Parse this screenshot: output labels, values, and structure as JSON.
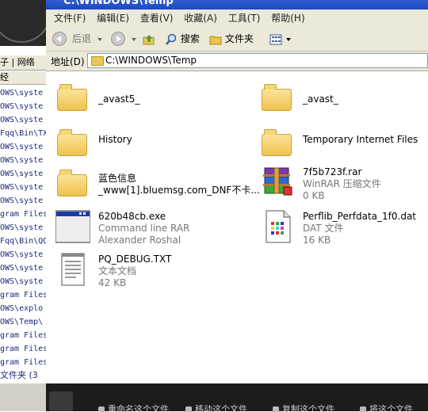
{
  "background_window": {
    "tabs_text": "子 | 网络",
    "header_text": "经",
    "rows": [
      "OWS\\syste",
      "OWS\\syste",
      "OWS\\syste",
      "Fqq\\Bin\\TX",
      "OWS\\syste",
      "OWS\\syste",
      "OWS\\syste",
      "OWS\\syste",
      "OWS\\syste",
      "gram Files",
      "OWS\\syste",
      "Fqq\\Bin\\QQ",
      "OWS\\syste",
      "OWS\\syste",
      "OWS\\syste",
      "gram Files",
      "OWS\\explo",
      "OWS\\Temp\\",
      "gram Files",
      "gram Files",
      "gram Files"
    ],
    "status": "文件夹 (3"
  },
  "window": {
    "title": "C:\\WINDOWS\\Temp"
  },
  "menu": [
    "文件(F)",
    "编辑(E)",
    "查看(V)",
    "收藏(A)",
    "工具(T)",
    "帮助(H)"
  ],
  "toolbar": {
    "back": "后退",
    "search": "搜索",
    "folders": "文件夹"
  },
  "address": {
    "label": "地址(D)",
    "value": "C:\\WINDOWS\\Temp"
  },
  "items": [
    {
      "name": "_avast5_",
      "line2": "",
      "line3": "",
      "icon": "folder"
    },
    {
      "name": "_avast_",
      "line2": "",
      "line3": "",
      "icon": "folder"
    },
    {
      "name": "History",
      "line2": "",
      "line3": "",
      "icon": "folder"
    },
    {
      "name": "Temporary Internet Files",
      "line2": "",
      "line3": "",
      "icon": "folder"
    },
    {
      "name": "蓝色信息",
      "line2": "_www[1].bluemsg.com_DNF不卡...",
      "line3": "",
      "icon": "folder"
    },
    {
      "name": "7f5b723f.rar",
      "line2": "WinRAR 压缩文件",
      "line3": "0 KB",
      "icon": "winrar"
    },
    {
      "name": "620b48cb.exe",
      "line2": "Command line RAR",
      "line3": "Alexander Roshal",
      "icon": "exe-window"
    },
    {
      "name": "Perflib_Perfdata_1f0.dat",
      "line2": "DAT 文件",
      "line3": "16 KB",
      "icon": "dat-file"
    },
    {
      "name": "PQ_DEBUG.TXT",
      "line2": "文本文档",
      "line3": "42 KB",
      "icon": "text-file"
    }
  ],
  "taskbar": [
    "重命名这个文件",
    "移动这个文件",
    "复制这个文件",
    "将这个文件"
  ]
}
